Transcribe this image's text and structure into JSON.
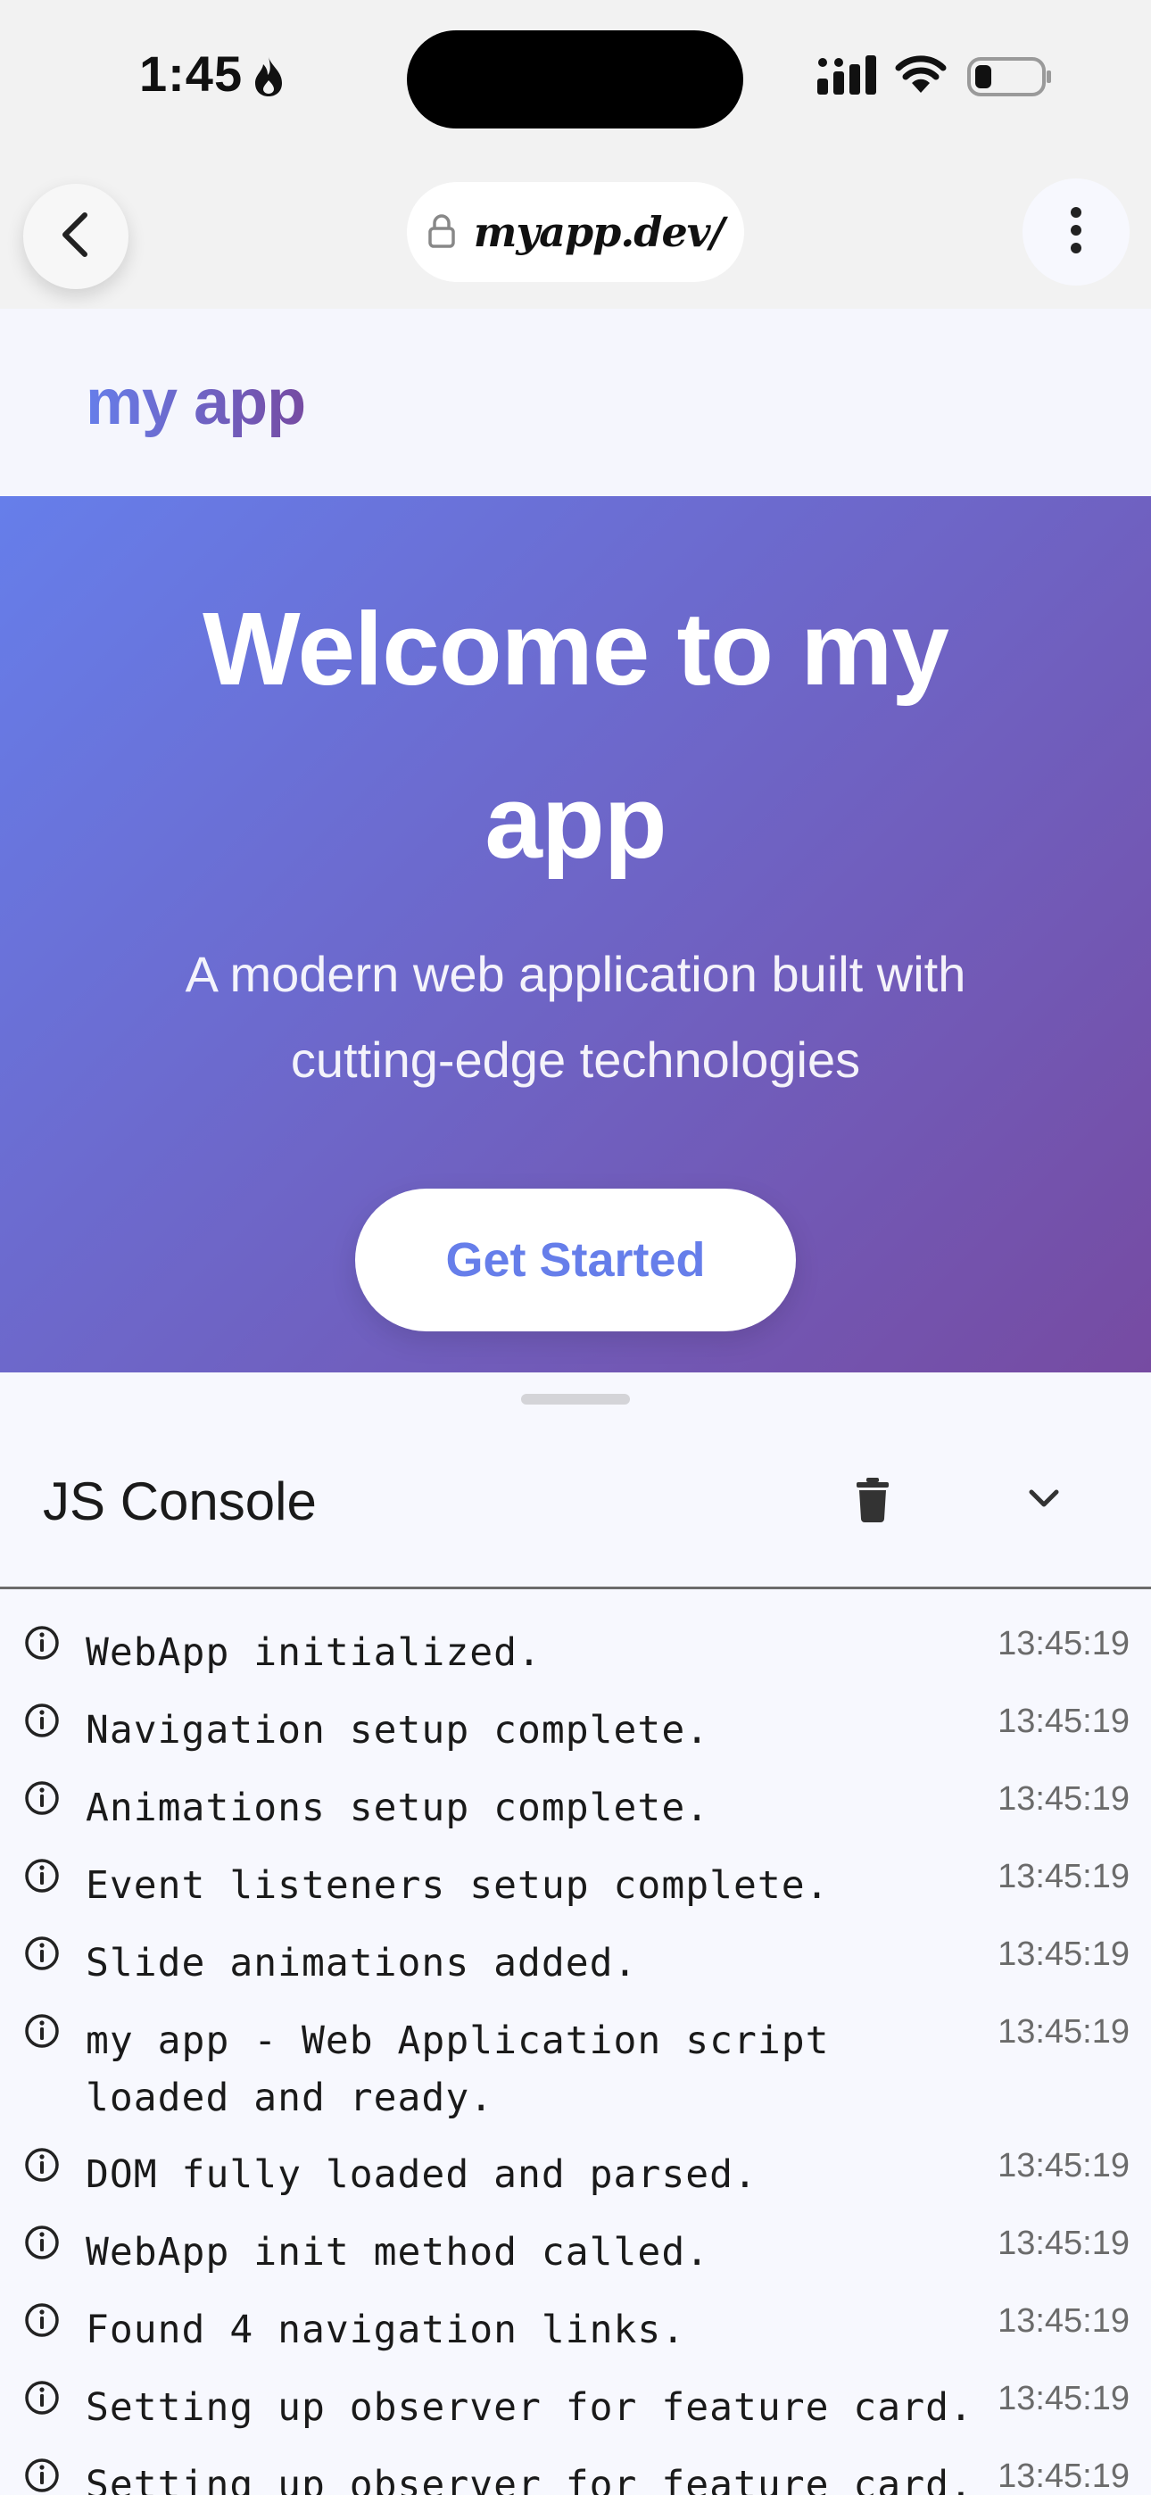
{
  "status_bar": {
    "time": "1:45"
  },
  "browser": {
    "url": "myapp.dev/"
  },
  "site": {
    "logo": "my app"
  },
  "hero": {
    "title": "Welcome to my app",
    "subtitle": "A modern web application built with cutting-edge technologies",
    "cta_label": "Get Started"
  },
  "console": {
    "title": "JS Console",
    "logs": [
      {
        "message": "WebApp initialized.",
        "time": "13:45:19"
      },
      {
        "message": "Navigation setup complete.",
        "time": "13:45:19"
      },
      {
        "message": "Animations setup complete.",
        "time": "13:45:19"
      },
      {
        "message": "Event listeners setup complete.",
        "time": "13:45:19"
      },
      {
        "message": "Slide animations added.",
        "time": "13:45:19"
      },
      {
        "message": "my app - Web Application script loaded and ready.",
        "time": "13:45:19"
      },
      {
        "message": "DOM fully loaded and parsed.",
        "time": "13:45:19"
      },
      {
        "message": "WebApp init method called.",
        "time": "13:45:19"
      },
      {
        "message": "Found 4 navigation links.",
        "time": "13:45:19"
      },
      {
        "message": "Setting up observer for feature card.",
        "time": "13:45:19"
      },
      {
        "message": "Setting up observer for feature card.",
        "time": "13:45:19"
      }
    ]
  },
  "colors": {
    "gradient_start": "#667eea",
    "gradient_end": "#764ba2"
  }
}
